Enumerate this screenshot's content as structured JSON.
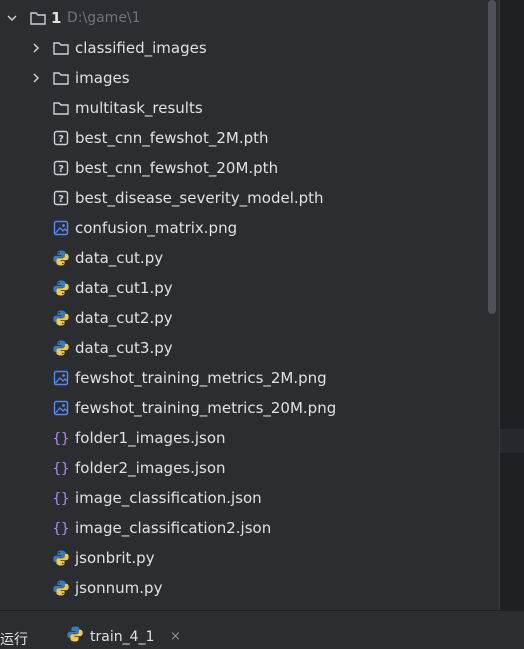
{
  "tree": {
    "root": {
      "name": "1",
      "path": "D:\\game\\1"
    },
    "folders": [
      {
        "name": "classified_images",
        "expandable": true
      },
      {
        "name": "images",
        "expandable": true
      },
      {
        "name": "multitask_results",
        "expandable": false
      }
    ],
    "files": [
      {
        "name": "best_cnn_fewshot_2M.pth",
        "icon": "unknown-file-icon"
      },
      {
        "name": "best_cnn_fewshot_20M.pth",
        "icon": "unknown-file-icon"
      },
      {
        "name": "best_disease_severity_model.pth",
        "icon": "unknown-file-icon"
      },
      {
        "name": "confusion_matrix.png",
        "icon": "image-file-icon"
      },
      {
        "name": "data_cut.py",
        "icon": "python-icon"
      },
      {
        "name": "data_cut1.py",
        "icon": "python-icon"
      },
      {
        "name": "data_cut2.py",
        "icon": "python-icon"
      },
      {
        "name": "data_cut3.py",
        "icon": "python-icon"
      },
      {
        "name": "fewshot_training_metrics_2M.png",
        "icon": "image-file-icon"
      },
      {
        "name": "fewshot_training_metrics_20M.png",
        "icon": "image-file-icon"
      },
      {
        "name": "folder1_images.json",
        "icon": "json-icon"
      },
      {
        "name": "folder2_images.json",
        "icon": "json-icon"
      },
      {
        "name": "image_classification.json",
        "icon": "json-icon"
      },
      {
        "name": "image_classification2.json",
        "icon": "json-icon"
      },
      {
        "name": "jsonbrit.py",
        "icon": "python-icon"
      },
      {
        "name": "jsonnum.py",
        "icon": "python-icon"
      }
    ]
  },
  "bottom_bar": {
    "run_label": "运行",
    "tab_label": "train_4_1",
    "close_glyph": "×"
  },
  "colors": {
    "background": "#2b2d30",
    "text": "#dfe1e5",
    "path_text": "#6f737a",
    "folder_icon": "#ced0d6",
    "image_icon": "#548af7",
    "json_icon": "#b189f5",
    "python_blue": "#3d7ab8",
    "python_yellow": "#f2c94c"
  }
}
